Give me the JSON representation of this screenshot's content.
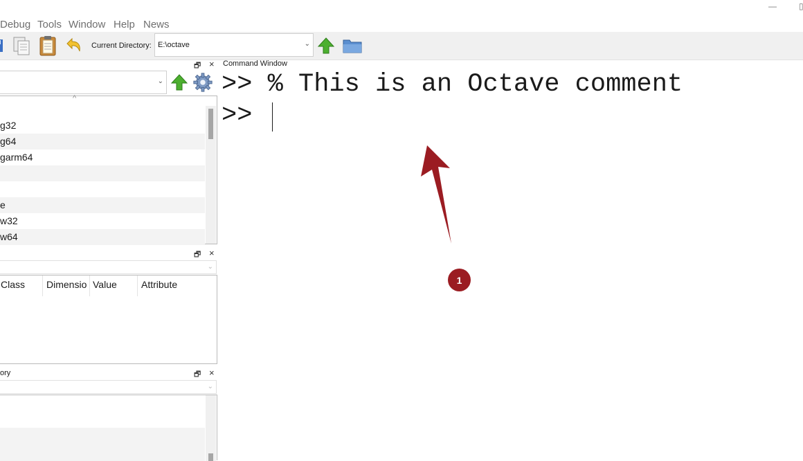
{
  "window": {
    "minimize_glyph": "—",
    "maximize_glyph": "▯"
  },
  "menu": [
    "Debug",
    "Tools",
    "Window",
    "Help",
    "News"
  ],
  "toolbar": {
    "icons": [
      "save-icon",
      "copy-icon",
      "paste-icon",
      "undo-icon",
      "up-arrow-icon",
      "folder-icon"
    ],
    "current_directory_label": "Current Directory:",
    "current_directory_value": "E:\\octave"
  },
  "file_browser": {
    "dock_undock_glyph": "🗗",
    "close_glyph": "×",
    "sort_indicator": "^",
    "rows": [
      "g32",
      "g64",
      "garm64",
      "",
      "",
      "e",
      "w32",
      "w64"
    ]
  },
  "workspace": {
    "dock_undock_glyph": "🗗",
    "close_glyph": "×",
    "columns": [
      "Class",
      "Dimensio",
      "Value",
      "Attribute"
    ]
  },
  "history": {
    "title": "ory",
    "dock_undock_glyph": "🗗",
    "close_glyph": "×"
  },
  "command_window": {
    "title": "Command Window",
    "lines": [
      ">> % This is an Octave comment",
      ">> "
    ]
  },
  "annotation": {
    "badge_number": "1",
    "color": "#9b1c22"
  }
}
